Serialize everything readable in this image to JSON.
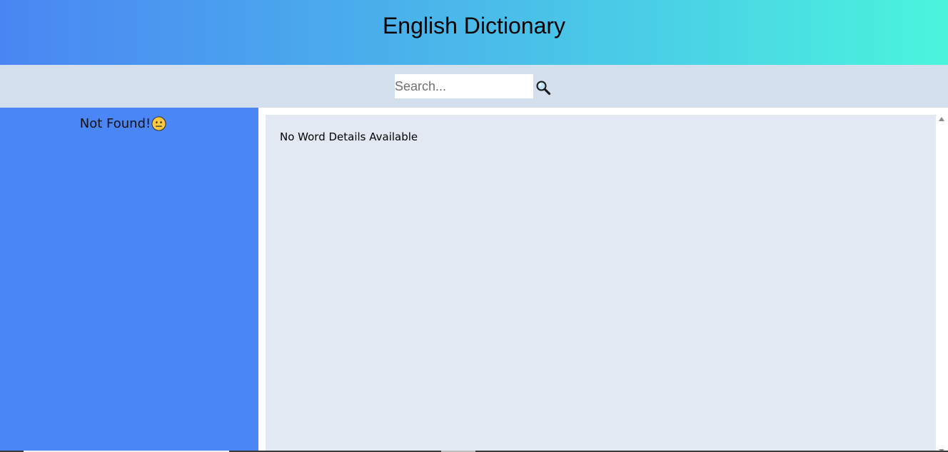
{
  "header": {
    "title": "English Dictionary"
  },
  "search": {
    "placeholder": "Search...",
    "value": "",
    "button_icon": "magnifier-icon"
  },
  "sidebar": {
    "status_text": "Not Found!",
    "status_icon": "neutral-face-icon"
  },
  "main": {
    "details_text": "No Word Details Available"
  },
  "colors": {
    "header_gradient_start": "#4a86f3",
    "header_gradient_end": "#4af5dc",
    "search_bar_bg": "#d3dfec",
    "sidebar_bg": "#4a86f5",
    "details_bg": "#e3e9f3"
  }
}
